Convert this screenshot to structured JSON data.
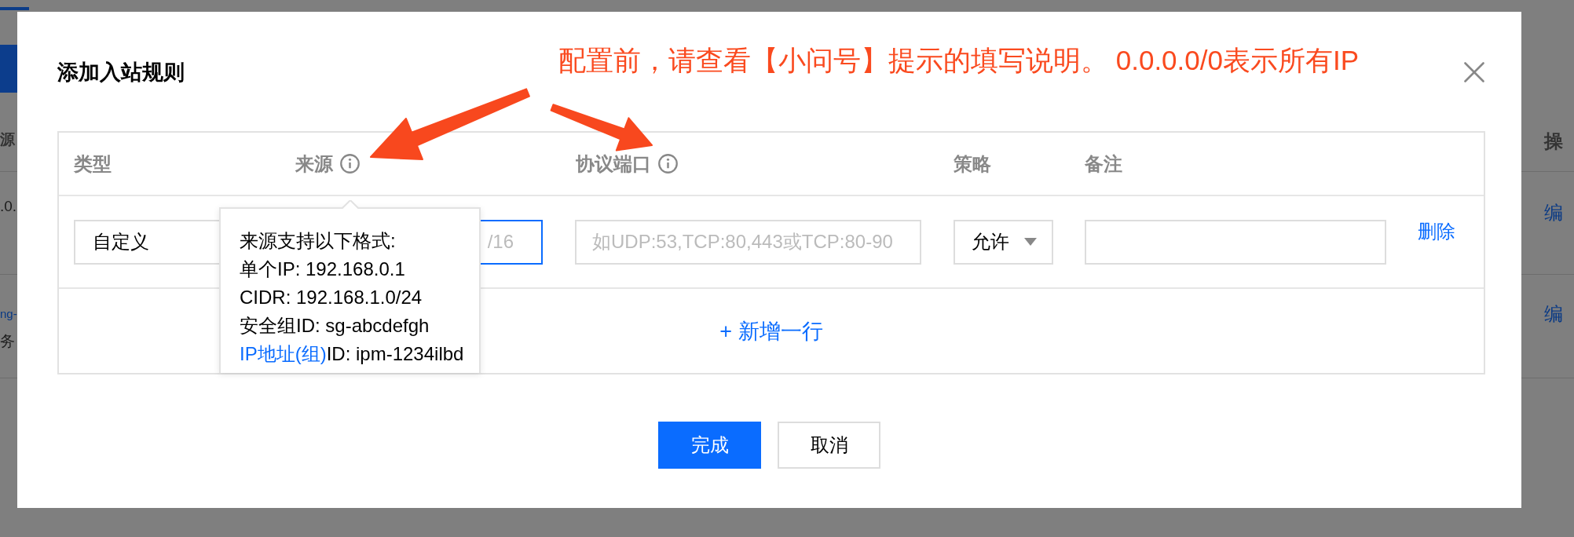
{
  "background_page": {
    "left_edge": {
      "header": "源",
      "rows": [
        {
          "lines": [
            {
              "kind": "text",
              "text": ".0."
            }
          ]
        },
        {
          "lines": [
            {
              "kind": "link",
              "text": "ng-"
            },
            {
              "kind": "text",
              "text": "务"
            }
          ]
        }
      ]
    },
    "right_edge": {
      "header": "操",
      "rows": [
        {
          "lines": [
            {
              "kind": "link",
              "text": "编"
            }
          ]
        },
        {
          "lines": [
            {
              "kind": "link",
              "text": "编"
            }
          ]
        }
      ]
    }
  },
  "dialog": {
    "title": "添加入站规则",
    "annotation": "配置前，请查看【小问号】提示的填写说明。 0.0.0.0/0表示所有IP",
    "table": {
      "columns": [
        {
          "label": "类型",
          "info": false
        },
        {
          "label": "来源",
          "info": true
        },
        {
          "label": "协议端口",
          "info": true
        },
        {
          "label": "策略",
          "info": false
        },
        {
          "label": "备注",
          "info": false
        }
      ],
      "rows": [
        {
          "type": {
            "value": "自定义"
          },
          "source": {
            "placeholder": "/16",
            "focused": true
          },
          "port": {
            "placeholder": "如UDP:53,TCP:80,443或TCP:80-90",
            "focused": false
          },
          "policy": {
            "value": "允许"
          },
          "remark": {
            "focused": false
          },
          "action": "删除"
        }
      ],
      "add_row": "+ 新增一行",
      "tooltip": {
        "lines": [
          {
            "text": "来源支持以下格式:"
          },
          {
            "text": "单个IP: 192.168.0.1"
          },
          {
            "text": "CIDR: 192.168.1.0/24"
          },
          {
            "text": "安全组ID: sg-abcdefgh"
          },
          {
            "link": "IP地址(组)",
            "text": "ID: ipm-1234ilbd"
          }
        ]
      }
    },
    "buttons": [
      {
        "label": "完成",
        "kind": "primary"
      },
      {
        "label": "取消",
        "kind": "default"
      }
    ]
  }
}
